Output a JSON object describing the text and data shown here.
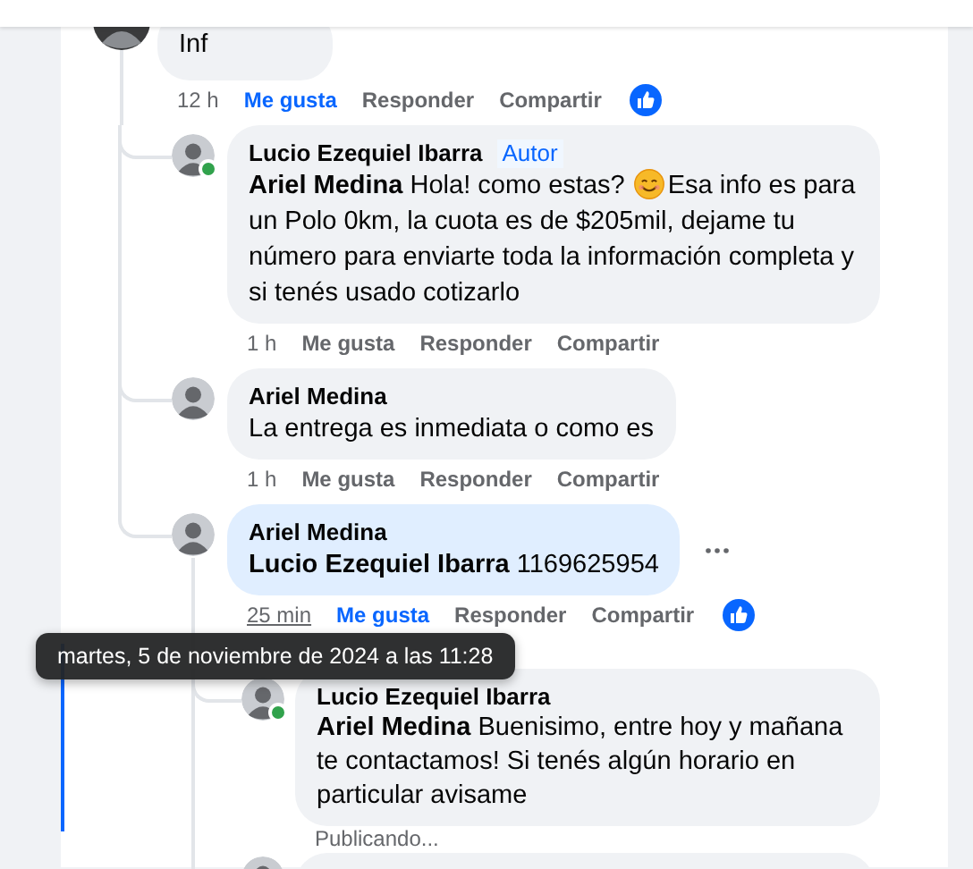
{
  "tooltip": "martes, 5 de noviembre de 2024 a las 11:28",
  "comments": [
    {
      "kind": "comment",
      "text": "Inf",
      "time": "12 h",
      "time_hovered": false,
      "like": "Me gusta",
      "liked": true,
      "reply": "Responder",
      "share": "Compartir",
      "reacted": true,
      "children": [
        {
          "kind": "comment",
          "name": "Lucio Ezequiel Ibarra",
          "badge": "Autor",
          "online": true,
          "mention": "Ariel Medina",
          "text": "Hola! como estas? ",
          "emoji": true,
          "text_after": "Esa info es para un Polo 0km, la cuota es de $205mil, dejame tu número para enviarte toda la información completa y si tenés usado cotizarlo",
          "time": "1 h",
          "time_hovered": false,
          "like": "Me gusta",
          "liked": false,
          "reply": "Responder",
          "share": "Compartir"
        },
        {
          "kind": "comment",
          "name": "Ariel Medina",
          "text": "La entrega es inmediata o como es",
          "time": "1 h",
          "time_hovered": false,
          "like": "Me gusta",
          "liked": false,
          "reply": "Responder",
          "share": "Compartir"
        },
        {
          "kind": "comment",
          "name": "Ariel Medina",
          "highlighted": true,
          "menu": true,
          "mention": "Lucio Ezequiel Ibarra",
          "text": "1169625954",
          "time": "25 min",
          "time_hovered": true,
          "like": "Me gusta",
          "liked": true,
          "reply": "Responder",
          "share": "Compartir",
          "reacted": true,
          "children": [
            {
              "kind": "comment",
              "name": "Lucio Ezequiel Ibarra",
              "online": true,
              "mention": "Ariel Medina",
              "text": "Buenisimo, entre hoy y mañana te contactamos! Si tenés algún horario en particular avisame",
              "status": "Publicando..."
            },
            {
              "kind": "cut"
            }
          ]
        }
      ]
    }
  ]
}
